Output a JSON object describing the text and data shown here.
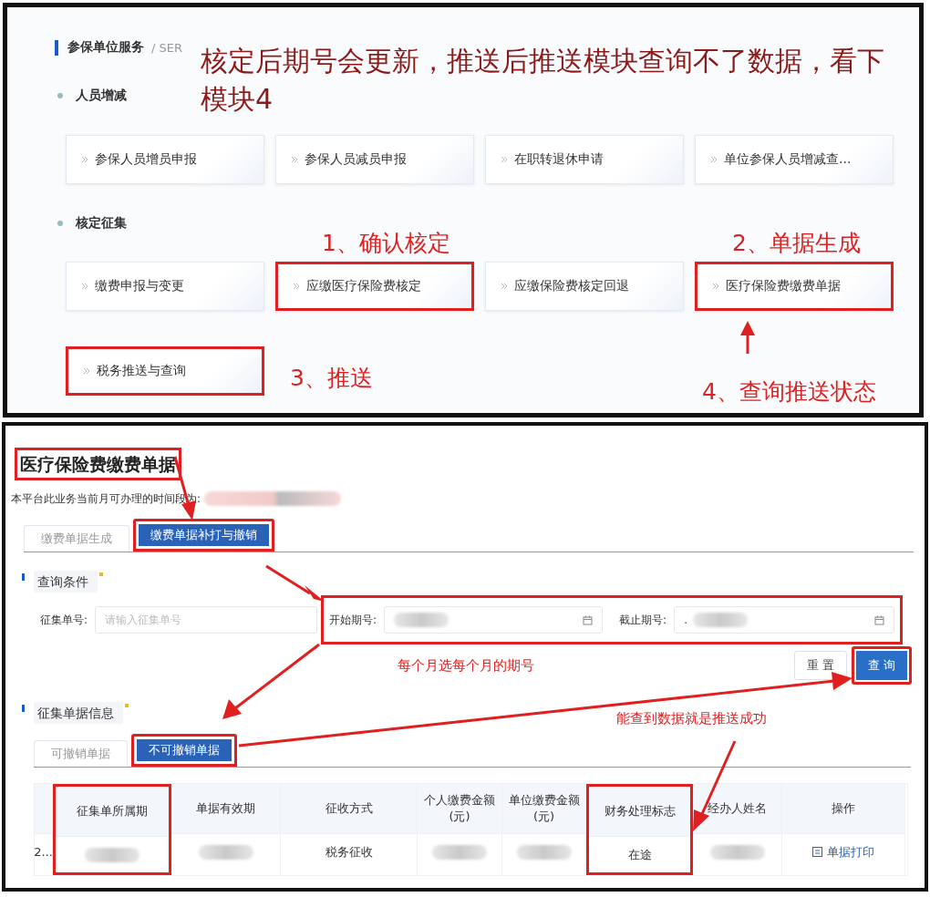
{
  "top_panel": {
    "section_title": "参保单位服务",
    "section_subtitle": "/ SER",
    "groups": [
      {
        "label": "人员增减",
        "items": [
          {
            "label": "参保人员增员申报",
            "highlighted": false
          },
          {
            "label": "参保人员减员申报",
            "highlighted": false
          },
          {
            "label": "在职转退休申请",
            "highlighted": false
          },
          {
            "label": "单位参保人员增减查...",
            "highlighted": false
          }
        ]
      },
      {
        "label": "核定征集",
        "items": [
          {
            "label": "缴费申报与变更",
            "highlighted": false
          },
          {
            "label": "应缴医疗保险费核定",
            "highlighted": true
          },
          {
            "label": "应缴保险费核定回退",
            "highlighted": false
          },
          {
            "label": "医疗保险费缴费单据",
            "highlighted": true
          },
          {
            "label": "税务推送与查询",
            "highlighted": true
          }
        ]
      }
    ],
    "note": "核定后期号会更新，推送后推送模块查询不了数据，看下模块4",
    "steps": [
      "1、确认核定",
      "2、单据生成",
      "3、推送",
      "4、查询推送状态"
    ]
  },
  "bill_page": {
    "title": "医疗保险费缴费单据",
    "title_highlighted": true,
    "period_label": "本平台此业务当前月可办理的时间段为:",
    "tabs": [
      {
        "label": "缴费单据生成",
        "selected": false,
        "highlighted": false
      },
      {
        "label": "缴费单据补打与撤销",
        "selected": true,
        "highlighted": true
      }
    ],
    "query_section": {
      "title": "查询条件",
      "fields": [
        {
          "label": "征集单号:",
          "kind": "text",
          "placeholder": "请输入征集单号"
        },
        {
          "label": "开始期号:",
          "kind": "date"
        },
        {
          "label": "截止期号:",
          "kind": "date",
          "prefix": "."
        }
      ],
      "period_fields_highlighted": true,
      "note": "每个月选每个月的期号",
      "buttons": [
        {
          "label": "重 置",
          "kind": "default",
          "highlighted": false
        },
        {
          "label": "查 询",
          "kind": "primary",
          "highlighted": true
        }
      ]
    },
    "info_section": {
      "title": "征集单据信息",
      "note": "能查到数据就是推送成功",
      "tabs": [
        {
          "label": "可撤销单据",
          "selected": false,
          "highlighted": false
        },
        {
          "label": "不可撤销单据",
          "selected": true,
          "highlighted": true
        }
      ],
      "table": {
        "columns": [
          {
            "highlighted": false
          },
          {
            "label": "征集单所属期",
            "highlighted": true
          },
          {
            "label": "单据有效期",
            "highlighted": false
          },
          {
            "label": "征收方式",
            "highlighted": false
          },
          {
            "label": "个人缴费金额(元)",
            "highlighted": false
          },
          {
            "label": "单位缴费金额(元)",
            "highlighted": false
          },
          {
            "label": "财务处理标志",
            "highlighted": true
          },
          {
            "label": "经办人姓名",
            "highlighted": false
          },
          {
            "label": "操作",
            "highlighted": false
          }
        ],
        "rows": [
          {
            "cells": [
              {
                "kind": "text",
                "text": "2..."
              },
              {
                "kind": "redacted"
              },
              {
                "kind": "redacted"
              },
              {
                "kind": "text",
                "text": "税务征收"
              },
              {
                "kind": "redacted"
              },
              {
                "kind": "redacted"
              },
              {
                "kind": "text",
                "text": "在途"
              },
              {
                "kind": "redacted"
              },
              {
                "kind": "link",
                "text": "单据打印"
              }
            ]
          }
        ]
      }
    }
  }
}
